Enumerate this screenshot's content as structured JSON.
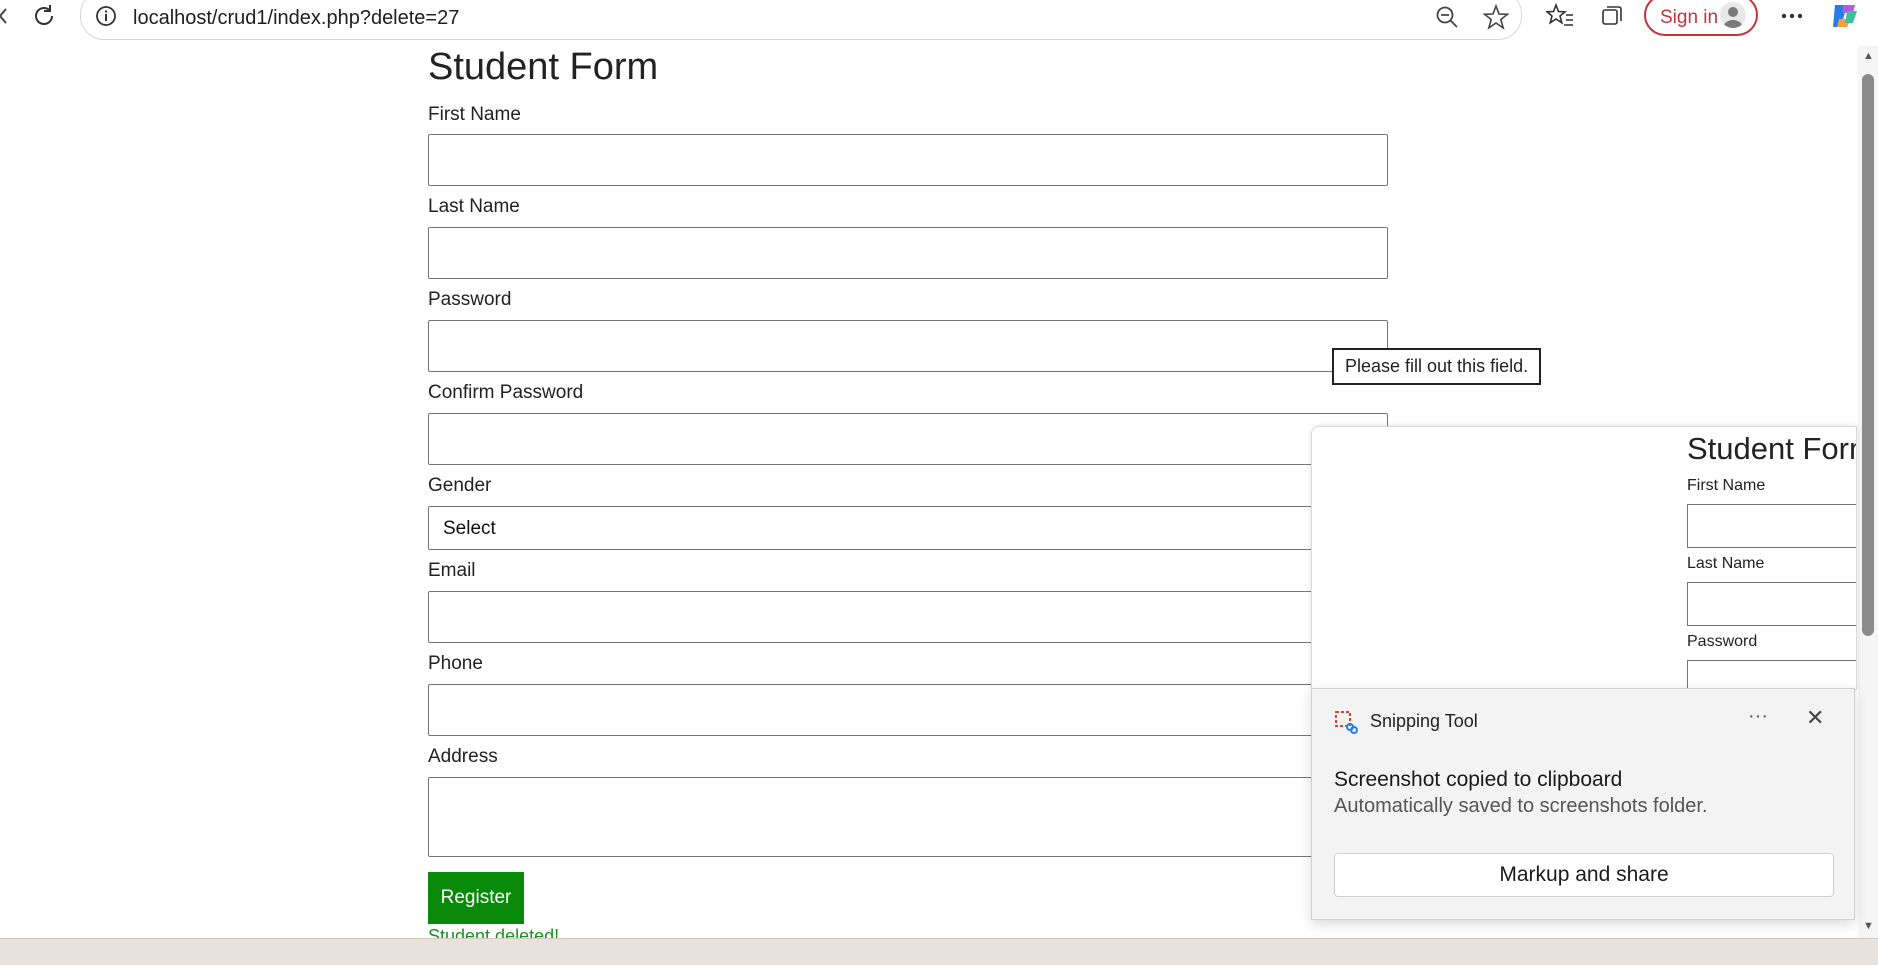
{
  "browser": {
    "url": "localhost/crud1/index.php?delete=27",
    "sign_in": "Sign in"
  },
  "form": {
    "title": "Student Form",
    "first_name_label": "First Name",
    "last_name_label": "Last Name",
    "password_label": "Password",
    "confirm_password_label": "Confirm Password",
    "gender_label": "Gender",
    "gender_selected": "Select",
    "email_label": "Email",
    "phone_label": "Phone",
    "address_label": "Address",
    "register_button": "Register",
    "status_message": "Student deleted!"
  },
  "tooltip": {
    "text": "Please fill out this field."
  },
  "preview": {
    "title": "Student Form",
    "first_name_label": "First Name",
    "last_name_label": "Last Name",
    "password_label": "Password"
  },
  "toast": {
    "app_name": "Snipping Tool",
    "heading": "Screenshot copied to clipboard",
    "body": "Automatically saved to screenshots folder.",
    "action": "Markup and share",
    "more": "···",
    "close": "✕"
  },
  "colors": {
    "accent_green": "#0a8a0a",
    "signin_red": "#c4343a"
  }
}
